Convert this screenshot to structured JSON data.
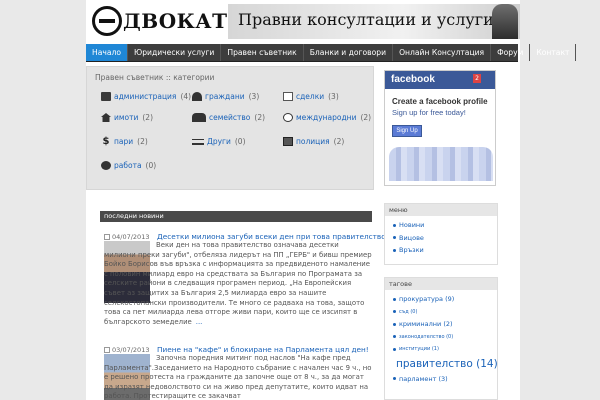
{
  "header": {
    "logo_text": "ДВОКАТ",
    "banner_text": "Правни консултации и услуги"
  },
  "nav": [
    "Начало",
    "Юридически услуги",
    "Правен съветник",
    "Бланки и договори",
    "Онлайн Консултация",
    "Форум",
    "Контакт"
  ],
  "categories": {
    "title": "Правен съветник :: категории",
    "items": [
      {
        "label": "администрация",
        "count": "(4)",
        "icon": "monitor-icon"
      },
      {
        "label": "граждани",
        "count": "(3)",
        "icon": "person-icon"
      },
      {
        "label": "сделки",
        "count": "(3)",
        "icon": "document-icon"
      },
      {
        "label": "имоти",
        "count": "(2)",
        "icon": "house-icon"
      },
      {
        "label": "семейство",
        "count": "(2)",
        "icon": "family-icon"
      },
      {
        "label": "международни",
        "count": "(2)",
        "icon": "globe-icon"
      },
      {
        "label": "пари",
        "count": "(2)",
        "icon": "dollar-icon"
      },
      {
        "label": "Други",
        "count": "(0)",
        "icon": "scales-icon"
      },
      {
        "label": "полиция",
        "count": "(2)",
        "icon": "police-icon"
      },
      {
        "label": "работа",
        "count": "(0)",
        "icon": "gears-icon"
      }
    ]
  },
  "facebook": {
    "logo": "facebook",
    "badge": "2",
    "title": "Create a facebook profile",
    "sub": "Sign up for free today!",
    "signup": "Sign Up"
  },
  "news": {
    "heading": "последни новини",
    "items": [
      {
        "date": "04/07/2013",
        "title": "Десетки милиона загуби всеки ден при това правителство!",
        "body": "Веки ден на това правителство означава десетки милиони преки загуби\", отбеляза лидерът на ПП „ГЕРБ\" и бивш премиер Бойко Борисов във връзка с информацията за предвиденото намаление с половин милиард евро на средствата за България по Програмата за селските райони в следващия програмен период. „На Европейския съвет аз защитих за България 2,5 милиарда евро за нашите селскостопански производители. Те много се радваха на това, защото това са пет милиарда лева отгоре живи пари, които ще се изсипят в българското земеделие",
        "more": "..."
      },
      {
        "date": "03/07/2013",
        "title": "Пиене на \"кафе\" и блокиране на Парламента цял ден!",
        "body": "Започна поредния митинг под наслов \"На кафе пред Парламента\".Заседанието на Народното събрание с начален час 9 ч., но е решено протеста на гражданите да започне още от 8 ч., за да могат да изразят недоволството си на живо пред депутатите, които идват на работа. Протестиращите се закачват"
      }
    ]
  },
  "menu": {
    "heading": "меню",
    "items": [
      "Новини",
      "Вицове",
      "Връзки"
    ]
  },
  "tags": {
    "heading": "тагове",
    "items": [
      {
        "label": "прокуратура",
        "count": "(9)",
        "size": "sm"
      },
      {
        "label": "съд",
        "count": "(0)",
        "size": "tiny"
      },
      {
        "label": "криминални",
        "count": "(2)",
        "size": "sm"
      },
      {
        "label": "законодателство",
        "count": "(0)",
        "size": "tiny"
      },
      {
        "label": "институции",
        "count": "(1)",
        "size": "tiny"
      },
      {
        "label": "правителство",
        "count": "(14)",
        "size": "big"
      },
      {
        "label": "парламент",
        "count": "(3)",
        "size": "sm"
      }
    ]
  }
}
